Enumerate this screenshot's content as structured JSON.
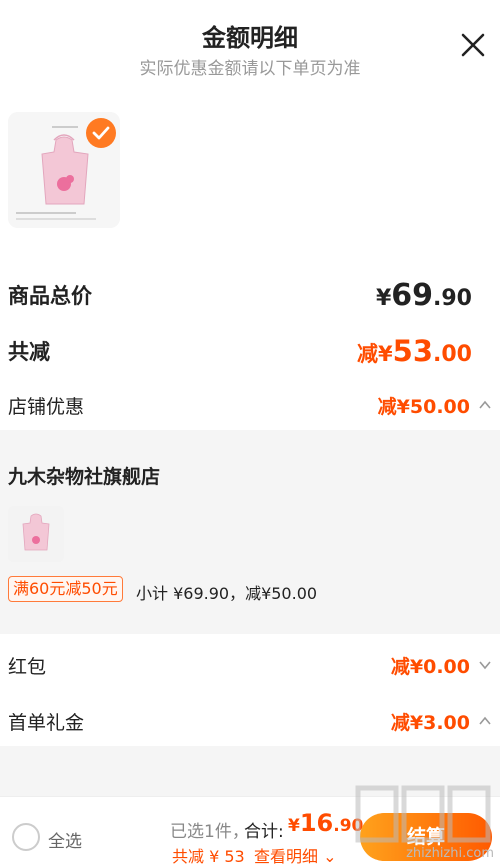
{
  "header": {
    "title": "金额明细",
    "subtitle": "实际优惠金额请以下单页为准",
    "close_icon": "close-icon"
  },
  "product": {
    "image_icon": "apron-product-image",
    "selected": true
  },
  "summary": {
    "goods_total_label": "商品总价",
    "goods_total_currency": "¥",
    "goods_total_int": "69",
    "goods_total_dec": ".90",
    "discount_label": "共减",
    "discount_value_prefix": "减¥",
    "discount_value_int": "53",
    "discount_value_dec": ".00"
  },
  "store_discount": {
    "label": "店铺优惠",
    "value": "减¥50.00",
    "expanded": true
  },
  "store": {
    "name": "九木杂物社旗舰店",
    "promo_tag": "满60元减50元",
    "promo_text": "小计 ¥69.90，减¥50.00"
  },
  "red_packet": {
    "label": "红包",
    "value": "减¥0.00",
    "expanded": false
  },
  "first_order": {
    "label": "首单礼金",
    "value": "减¥3.00",
    "expanded": true
  },
  "bottom_bar": {
    "select_all": "全选",
    "chosen": "已选1件，",
    "total_label": "合计:",
    "total_currency": "¥",
    "total_int": "16",
    "total_dec": ".90",
    "saved": "共减 ¥ 53",
    "detail_link": "查看明细 ⌄",
    "checkout": "结算"
  },
  "watermark": {
    "text": "zhizhizhi.com"
  },
  "colors": {
    "accent": "#ff4c00",
    "check": "#ff7a22",
    "panel": "#f5f5f5"
  }
}
